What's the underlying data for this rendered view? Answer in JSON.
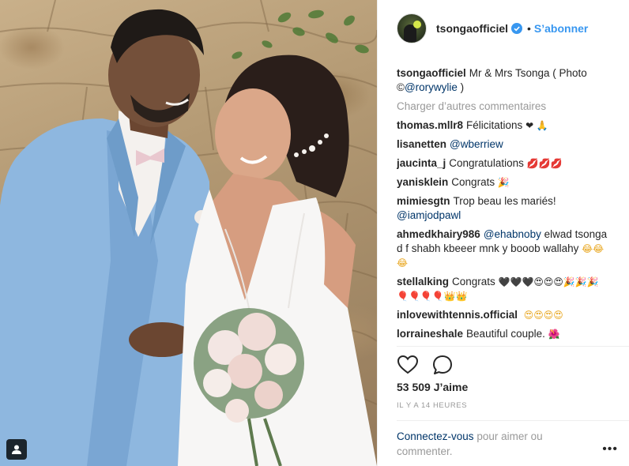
{
  "post": {
    "author": "tsongaofficiel",
    "follow_label": "S’abonner",
    "dot": "•",
    "caption_user": "tsongaofficiel",
    "caption_text": "Mr & Mrs Tsonga ( Photo ©",
    "caption_mention": "@rorywylie",
    "caption_end": " )",
    "load_more": "Charger d’autres commentaires",
    "likes": "53 509 J’aime",
    "timestamp": "IL Y A 14 HEURES",
    "login_link": "Connectez-vous",
    "login_text": " pour aimer ou commenter.",
    "more_options": "•••"
  },
  "comments": [
    {
      "user": "thomas.mllr8",
      "text": "Félicitations ",
      "emoji": "❤ 🙏"
    },
    {
      "user": "lisanetten",
      "mention": "@wberriew"
    },
    {
      "user": "jaucinta_j",
      "text": "Congratulations ",
      "emoji": "💋💋💋"
    },
    {
      "user": "yanisklein",
      "text": "Congrats ",
      "emoji": "🎉"
    },
    {
      "user": "mimiesgtn",
      "text": "Trop beau les mariés! ",
      "mention": "@iamjodpawl"
    },
    {
      "user": "ahmedkhairy986",
      "mention": "@ehabnoby",
      "text": " elwad tsonga d f shabh kbeeer mnk y booob wallahy ",
      "emoji": "😂😂😂"
    },
    {
      "user": "stellalking",
      "text": "Congrats ",
      "emoji": "🖤🖤🖤😍😍😍🎉🎉🎉🎈🎈🎈🎈👑👑"
    },
    {
      "user": "inlovewithtennis.official",
      "emoji": "😍😍😍😍"
    },
    {
      "user": "lorraineshale",
      "text": "Beautiful couple. ",
      "emoji": "🌺"
    }
  ],
  "colors": {
    "link_blue": "#3897f0",
    "mention_blue": "#003569",
    "muted_gray": "#999999",
    "text": "#262626"
  },
  "icons": {
    "verified": "verified-badge-icon",
    "like": "heart-outline-icon",
    "comment": "speech-bubble-icon",
    "user_tag": "user-tag-icon"
  }
}
